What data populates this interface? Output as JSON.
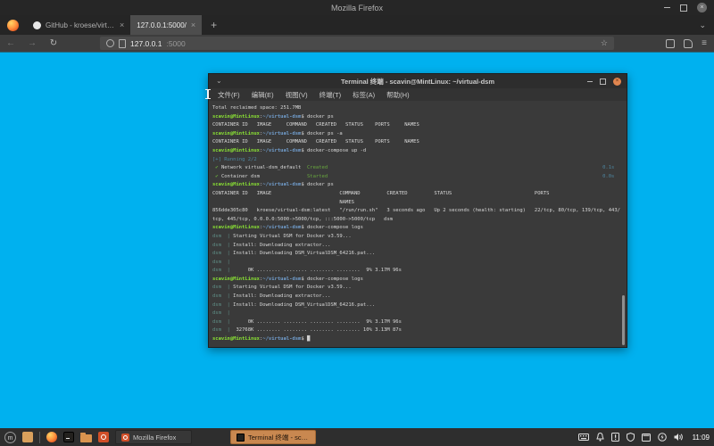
{
  "colors": {
    "desktop_background": "#00b1ef",
    "taskbar_active_button": "#c98850",
    "terminal_background": "#3a3a3a",
    "prompt_green": "#8ae234",
    "prompt_blue": "#729fcf",
    "status_green": "#68a83e",
    "status_blue": "#4e86a0"
  },
  "browser": {
    "window_title": "Mozilla Firefox",
    "tabs": [
      {
        "label": "GitHub - kroese/virtual-dsm",
        "close": "×",
        "active": false
      },
      {
        "label": "127.0.0.1:5000/",
        "close": "×",
        "active": true
      }
    ],
    "new_tab": "+",
    "tab_list_chevron": "⌄",
    "nav": {
      "back": "←",
      "forward": "→",
      "reload": "↻",
      "star": "☆",
      "menu": "≡"
    },
    "url": {
      "host": "127.0.0.1",
      "port": ":5000"
    }
  },
  "terminal": {
    "title": "Terminal 终端 - scavin@MintLinux: ~/virtual-dsm",
    "titlebar_chevron": "⌄",
    "close_glyph": "×",
    "menus": [
      "文件(F)",
      "编辑(E)",
      "视图(V)",
      "终端(T)",
      "标签(A)",
      "帮助(H)"
    ],
    "lines": [
      [
        [
          "w",
          "Total reclaimed space: 251.7MB"
        ]
      ],
      [
        [
          "g",
          "scavin@MintLinux"
        ],
        [
          "w",
          ":"
        ],
        [
          "b",
          "~/virtual-dsm"
        ],
        [
          "w",
          "$ docker ps"
        ]
      ],
      [
        [
          "w",
          "CONTAINER ID   IMAGE     COMMAND   CREATED   STATUS    PORTS     NAMES"
        ]
      ],
      [
        [
          "g",
          "scavin@MintLinux"
        ],
        [
          "w",
          ":"
        ],
        [
          "b",
          "~/virtual-dsm"
        ],
        [
          "w",
          "$ docker ps -a"
        ]
      ],
      [
        [
          "w",
          "CONTAINER ID   IMAGE     COMMAND   CREATED   STATUS    PORTS     NAMES"
        ]
      ],
      [
        [
          "g",
          "scavin@MintLinux"
        ],
        [
          "w",
          ":"
        ],
        [
          "b",
          "~/virtual-dsm"
        ],
        [
          "w",
          "$ docker-compose up -d"
        ]
      ],
      [
        [
          "db",
          "[+] Running 2/2"
        ]
      ],
      [
        [
          "dg",
          " ✔ "
        ],
        [
          "w",
          "Network virtual-dsm_default  "
        ],
        [
          "dg",
          "Created"
        ],
        [
          "w",
          "                                                                                             "
        ],
        [
          "db",
          "0.1s"
        ]
      ],
      [
        [
          "dg",
          " ✔ "
        ],
        [
          "w",
          "Container dsm                "
        ],
        [
          "dg",
          "Started"
        ],
        [
          "w",
          "                                                                                             "
        ],
        [
          "db",
          "0.0s"
        ]
      ],
      [
        [
          "g",
          "scavin@MintLinux"
        ],
        [
          "w",
          ":"
        ],
        [
          "b",
          "~/virtual-dsm"
        ],
        [
          "w",
          "$ docker ps"
        ]
      ],
      [
        [
          "w",
          "CONTAINER ID   IMAGE                       COMMAND         CREATED         STATUS                            PORTS"
        ]
      ],
      [
        [
          "w",
          "                                           NAMES"
        ]
      ],
      [
        [
          "w",
          "856dde305c80   kroese/virtual-dsm:latest   \"/run/run.sh\"   3 seconds ago   Up 2 seconds (health: starting)   22/tcp, 80/tcp, 139/tcp, 443/"
        ]
      ],
      [
        [
          "w",
          "tcp, 445/tcp, 0.0.0.0:5000->5000/tcp, :::5000->5000/tcp   dsm"
        ]
      ],
      [
        [
          "g",
          "scavin@MintLinux"
        ],
        [
          "w",
          ":"
        ],
        [
          "b",
          "~/virtual-dsm"
        ],
        [
          "w",
          "$ docker-compose logs"
        ]
      ],
      [
        [
          "sv",
          "dsm  |"
        ],
        [
          "w",
          " Starting Virtual DSM for Docker v3.59..."
        ]
      ],
      [
        [
          "sv",
          "dsm  |"
        ],
        [
          "w",
          " Install: Downloading extractor..."
        ]
      ],
      [
        [
          "sv",
          "dsm  |"
        ],
        [
          "w",
          " Install: Downloading DSM_VirtualDSM_64216.pat..."
        ]
      ],
      [
        [
          "sv",
          "dsm  |"
        ]
      ],
      [
        [
          "sv",
          "dsm  |"
        ],
        [
          "w",
          "      0K ........ ........ ........ ........  9% 3.17M 96s"
        ]
      ],
      [
        [
          "g",
          "scavin@MintLinux"
        ],
        [
          "w",
          ":"
        ],
        [
          "b",
          "~/virtual-dsm"
        ],
        [
          "w",
          "$ docker-compose logs"
        ]
      ],
      [
        [
          "sv",
          "dsm  |"
        ],
        [
          "w",
          " Starting Virtual DSM for Docker v3.59..."
        ]
      ],
      [
        [
          "sv",
          "dsm  |"
        ],
        [
          "w",
          " Install: Downloading extractor..."
        ]
      ],
      [
        [
          "sv",
          "dsm  |"
        ],
        [
          "w",
          " Install: Downloading DSM_VirtualDSM_64216.pat..."
        ]
      ],
      [
        [
          "sv",
          "dsm  |"
        ]
      ],
      [
        [
          "sv",
          "dsm  |"
        ],
        [
          "w",
          "      0K ........ ........ ........ ........  9% 3.17M 96s"
        ]
      ],
      [
        [
          "sv",
          "dsm  |"
        ],
        [
          "w",
          "  32768K ........ ........ ........ ........ 10% 3.13M 87s"
        ]
      ],
      [
        [
          "g",
          "scavin@MintLinux"
        ],
        [
          "w",
          ":"
        ],
        [
          "b",
          "~/virtual-dsm"
        ],
        [
          "w",
          "$ "
        ],
        [
          "cur",
          "█"
        ]
      ]
    ]
  },
  "taskbar": {
    "menu_glyph": "m",
    "window_buttons": [
      {
        "label": "Mozilla Firefox",
        "active": false
      },
      {
        "label": "Terminal 终端 - scavin@Mi...",
        "active": true
      }
    ],
    "clock": "11:09"
  }
}
